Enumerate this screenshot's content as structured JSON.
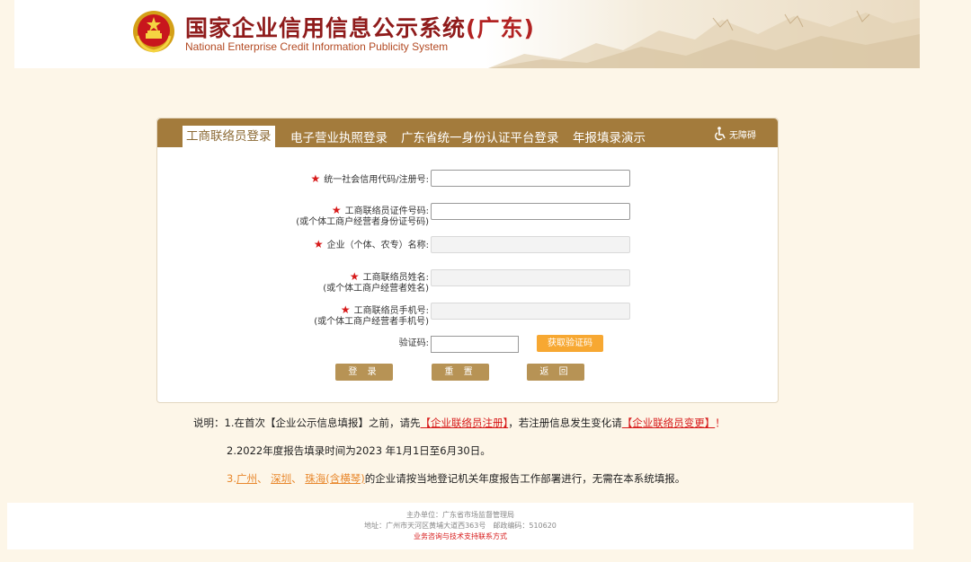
{
  "header": {
    "title_main": "国家企业信用信息公示系统",
    "title_region": "(广东)",
    "title_en": "National Enterprise Credit Information Publicity System"
  },
  "tabs": [
    {
      "label": "工商联络员登录",
      "active": true
    },
    {
      "label": "电子营业执照登录",
      "active": false
    },
    {
      "label": "广东省统一身份认证平台登录",
      "active": false
    },
    {
      "label": "年报填录演示",
      "active": false
    }
  ],
  "accessibility": {
    "label": "无障碍",
    "icon": "wheelchair-icon"
  },
  "form": {
    "required_mark": "★",
    "credit_code": {
      "label": "统一社会信用代码/注册号:",
      "value": ""
    },
    "liaison_id": {
      "label": "工商联络员证件号码:",
      "sublabel": "(或个体工商户经营者身份证号码)",
      "value": ""
    },
    "company_name": {
      "label": "企业（个体、农专）名称:",
      "value": ""
    },
    "liaison_name": {
      "label": "工商联络员姓名:",
      "sublabel": "(或个体工商户经营者姓名)",
      "value": ""
    },
    "liaison_phone": {
      "label": "工商联络员手机号:",
      "sublabel": "(或个体工商户经营者手机号)",
      "value": ""
    },
    "captcha": {
      "label": "验证码:",
      "value": ""
    },
    "get_code_label": "获取验证码",
    "login_label": "登 录",
    "reset_label": "重 置",
    "back_label": "返 回"
  },
  "notes": {
    "n1_prefix": "说明：1.在首次【企业公示信息填报】之前，请先",
    "n1_link1": "【企业联络员注册】",
    "n1_mid": "，若注册信息发生变化请",
    "n1_link2": "【企业联络员变更】",
    "n1_end": "！",
    "n2": "2.2022年度报告填录时间为2023 年1月1日至6月30日。",
    "n3_num": "3.",
    "n3_city1": "广州",
    "n3_sep1": "、 ",
    "n3_city2": "深圳",
    "n3_sep2": "、 ",
    "n3_city3": "珠海(含横琴)",
    "n3_rest": "的企业请按当地登记机关年度报告工作部署进行，无需在本系统填报。"
  },
  "footer": {
    "sponsor": "主办单位：广东省市场监督管理局",
    "address": "地址：广州市天河区黄埔大道西363号　邮政编码：510620",
    "contact_link": "业务咨询与技术支持联系方式"
  },
  "colors": {
    "brand_gold": "#a37b3c",
    "accent_red": "#d71a1a",
    "button_orange": "#f7a832",
    "button_tan": "#b79355"
  }
}
